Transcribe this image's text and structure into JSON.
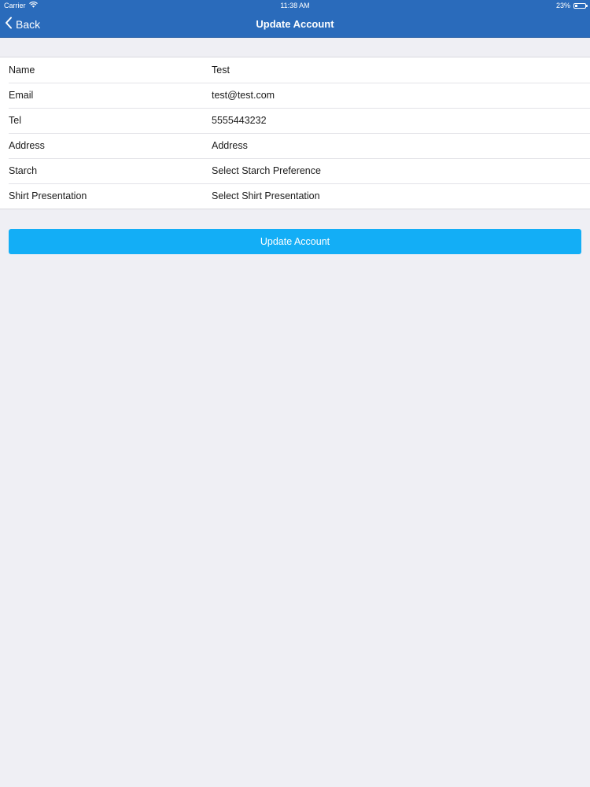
{
  "status_bar": {
    "carrier": "Carrier",
    "time": "11:38 AM",
    "battery_text": "23%",
    "battery_level": 0.23
  },
  "nav": {
    "back_label": "Back",
    "title": "Update Account"
  },
  "form": {
    "rows": [
      {
        "label": "Name",
        "value": "Test"
      },
      {
        "label": "Email",
        "value": "test@test.com"
      },
      {
        "label": "Tel",
        "value": "5555443232"
      },
      {
        "label": "Address",
        "value": "Address"
      },
      {
        "label": "Starch",
        "value": "Select Starch Preference"
      },
      {
        "label": "Shirt Presentation",
        "value": "Select Shirt Presentation"
      }
    ]
  },
  "actions": {
    "update_label": "Update Account"
  },
  "colors": {
    "nav_bar": "#2a6bbb",
    "primary_button": "#13aef6",
    "background": "#efeff4"
  },
  "icons": {
    "wifi": "wifi-icon",
    "battery": "battery-icon",
    "back": "chevron-left-icon"
  }
}
